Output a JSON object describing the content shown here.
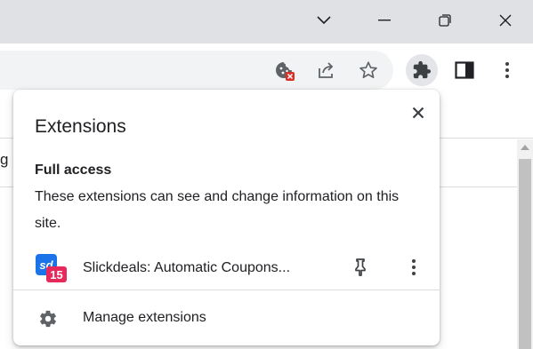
{
  "window_controls": {
    "tab_search_icon": "chevron-down-icon",
    "minimize_icon": "minimize-icon",
    "restore_icon": "restore-icon",
    "close_icon": "close-icon"
  },
  "toolbar": {
    "icons": [
      "cookie-blocked-icon",
      "share-icon",
      "star-icon",
      "extensions-puzzle-icon",
      "side-panel-icon",
      "more-vert-icon"
    ],
    "blocked_badge_color": "#d93025"
  },
  "page": {
    "stub_text": "g"
  },
  "popup": {
    "title": "Extensions",
    "close_icon": "close-icon",
    "full_access": {
      "heading": "Full access",
      "description": "These extensions can see and change information on this site."
    },
    "extensions": [
      {
        "name": "Slickdeals: Automatic Coupons...",
        "logo_text": "sd",
        "badge_text": "15",
        "logo_color": "#1a73e8",
        "badge_color": "#e7285a",
        "pin_icon": "pin-icon",
        "more_icon": "more-vert-icon"
      }
    ],
    "manage": {
      "label": "Manage extensions",
      "icon": "gear-icon"
    }
  },
  "colors": {
    "titlebar": "#dfe1e5",
    "omnibox": "#f1f3f4",
    "text": "#202124",
    "icon": "#5f6368"
  }
}
